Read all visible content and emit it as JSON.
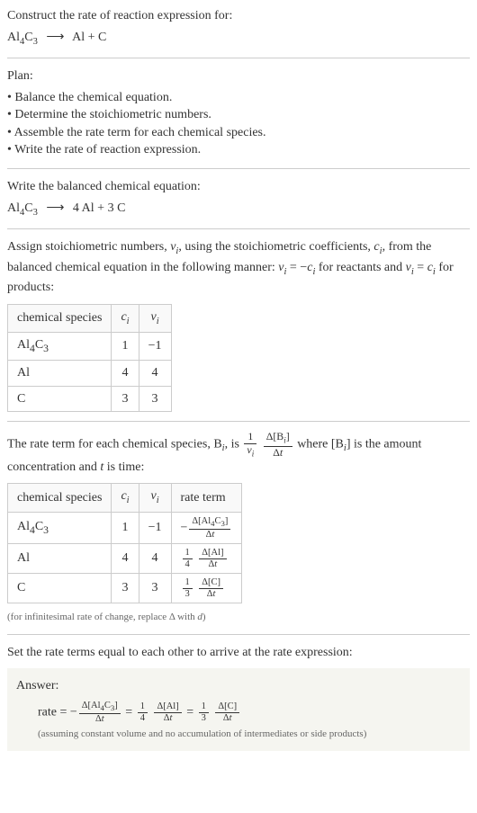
{
  "intro": {
    "prompt": "Construct the rate of reaction expression for:",
    "reaction_lhs": "Al",
    "reaction_lhs_sub1": "4",
    "reaction_lhs2": "C",
    "reaction_lhs_sub2": "3",
    "arrow": "⟶",
    "reaction_rhs": "Al + C"
  },
  "plan": {
    "heading": "Plan:",
    "items": [
      "• Balance the chemical equation.",
      "• Determine the stoichiometric numbers.",
      "• Assemble the rate term for each chemical species.",
      "• Write the rate of reaction expression."
    ]
  },
  "balanced": {
    "heading": "Write the balanced chemical equation:",
    "lhs": "Al",
    "lhs_sub1": "4",
    "lhs2": "C",
    "lhs_sub2": "3",
    "arrow": "⟶",
    "rhs1_coef": "4",
    "rhs1": "Al",
    "plus": "+",
    "rhs2_coef": "3",
    "rhs2": "C"
  },
  "stoich": {
    "text1": "Assign stoichiometric numbers, ",
    "nu_i": "ν",
    "nu_i_sub": "i",
    "text2": ", using the stoichiometric coefficients, ",
    "c_i": "c",
    "c_i_sub": "i",
    "text3": ", from the balanced chemical equation in the following manner: ",
    "eq1_lhs": "ν",
    "eq1_lhs_sub": "i",
    "eq1_eq": " = −",
    "eq1_rhs": "c",
    "eq1_rhs_sub": "i",
    "text4": " for reactants and ",
    "eq2_lhs": "ν",
    "eq2_lhs_sub": "i",
    "eq2_eq": " = ",
    "eq2_rhs": "c",
    "eq2_rhs_sub": "i",
    "text5": " for products:",
    "headers": {
      "species": "chemical species",
      "ci": "c",
      "ci_sub": "i",
      "nui": "ν",
      "nui_sub": "i"
    },
    "rows": [
      {
        "species_html": "Al<sub>4</sub>C<sub>3</sub>",
        "ci": "1",
        "nui": "−1"
      },
      {
        "species_html": "Al",
        "ci": "4",
        "nui": "4"
      },
      {
        "species_html": "C",
        "ci": "3",
        "nui": "3"
      }
    ]
  },
  "rateterm": {
    "text1": "The rate term for each chemical species, B",
    "sub_i": "i",
    "text2": ", is ",
    "frac1_num": "1",
    "frac1_den_sym": "ν",
    "frac1_den_sub": "i",
    "frac2_num_delta": "Δ[B",
    "frac2_num_sub": "i",
    "frac2_num_close": "]",
    "frac2_den": "Δt",
    "text3": " where [B",
    "text3_sub": "i",
    "text4": "] is the amount concentration and ",
    "t": "t",
    "text5": " is time:",
    "headers": {
      "species": "chemical species",
      "ci": "c",
      "ci_sub": "i",
      "nui": "ν",
      "nui_sub": "i",
      "rate": "rate term"
    },
    "rows": [
      {
        "species_html": "Al<sub>4</sub>C<sub>3</sub>",
        "ci": "1",
        "nui": "−1",
        "rate_prefix": "−",
        "rate_coef_num": "",
        "rate_coef_den": "",
        "rate_num": "Δ[Al<sub>4</sub>C<sub>3</sub>]",
        "rate_den": "Δt"
      },
      {
        "species_html": "Al",
        "ci": "4",
        "nui": "4",
        "rate_prefix": "",
        "rate_coef_num": "1",
        "rate_coef_den": "4",
        "rate_num": "Δ[Al]",
        "rate_den": "Δt"
      },
      {
        "species_html": "C",
        "ci": "3",
        "nui": "3",
        "rate_prefix": "",
        "rate_coef_num": "1",
        "rate_coef_den": "3",
        "rate_num": "Δ[C]",
        "rate_den": "Δt"
      }
    ],
    "note": "(for infinitesimal rate of change, replace Δ with d)"
  },
  "final": {
    "heading": "Set the rate terms equal to each other to arrive at the rate expression:"
  },
  "answer": {
    "label": "Answer:",
    "rate_label": "rate = ",
    "term1_prefix": "−",
    "term1_num": "Δ[Al<sub>4</sub>C<sub>3</sub>]",
    "term1_den": "Δt",
    "eq": " = ",
    "term2_coef_num": "1",
    "term2_coef_den": "4",
    "term2_num": "Δ[Al]",
    "term2_den": "Δt",
    "term3_coef_num": "1",
    "term3_coef_den": "3",
    "term3_num": "Δ[C]",
    "term3_den": "Δt",
    "note": "(assuming constant volume and no accumulation of intermediates or side products)"
  }
}
